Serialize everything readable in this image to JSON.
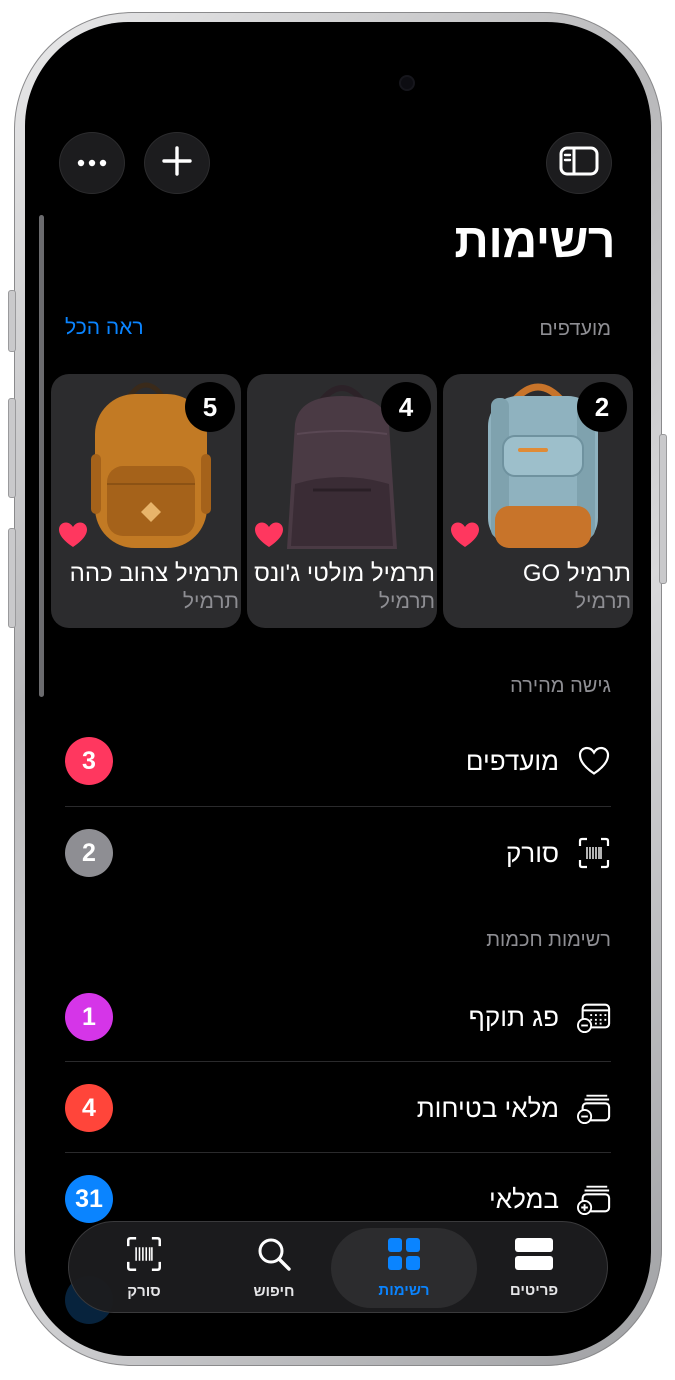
{
  "page": {
    "title": "רשימות"
  },
  "top_bar": {
    "more_icon": "ellipsis-icon",
    "add_icon": "plus-icon",
    "sidebar_icon": "sidebar-icon"
  },
  "favorites_section": {
    "label": "מועדפים",
    "see_all": "ראה הכל",
    "cards": [
      {
        "count": "2",
        "name": "תרמיל GO",
        "brand": "תרמיל",
        "favorite": true,
        "bag_color": "#8fb2bf",
        "accent": "#c8742a"
      },
      {
        "count": "4",
        "name": "תרמיל מולטי ג'ונס",
        "brand": "תרמיל",
        "favorite": true,
        "bag_color": "#4a3a44",
        "accent": "#3a2c35"
      },
      {
        "count": "5",
        "name": "תרמיל צהוב כהה",
        "brand": "תרמיל",
        "favorite": true,
        "bag_color": "#c27a24",
        "accent": "#a5621a"
      }
    ]
  },
  "quick_access": {
    "label": "גישה מהירה",
    "items": [
      {
        "label": "מועדפים",
        "count": "3",
        "icon": "heart-icon",
        "badge_color": "#ff375f"
      },
      {
        "label": "סורק",
        "count": "2",
        "icon": "barcode-scan-icon",
        "badge_color": "#8e8e93"
      }
    ]
  },
  "smart_lists": {
    "label": "רשימות חכמות",
    "items": [
      {
        "label": "פג תוקף",
        "count": "1",
        "icon": "calendar-minus-icon",
        "badge_color": "#d535e8"
      },
      {
        "label": "מלאי בטיחות",
        "count": "4",
        "icon": "stack-minus-icon",
        "badge_color": "#ff453a"
      },
      {
        "label": "במלאי",
        "count": "31",
        "icon": "stack-plus-icon",
        "badge_color": "#0a84ff"
      }
    ]
  },
  "tab_bar": {
    "tabs": [
      {
        "label": "סורק",
        "icon": "barcode-scan-icon",
        "active": false
      },
      {
        "label": "חיפוש",
        "icon": "search-icon",
        "active": false
      },
      {
        "label": "רשימות",
        "icon": "grid-icon",
        "active": true
      },
      {
        "label": "פריטים",
        "icon": "items-icon",
        "active": false
      }
    ]
  },
  "colors": {
    "accent": "#0a84ff",
    "background": "#000000",
    "card": "#2c2c2e"
  }
}
